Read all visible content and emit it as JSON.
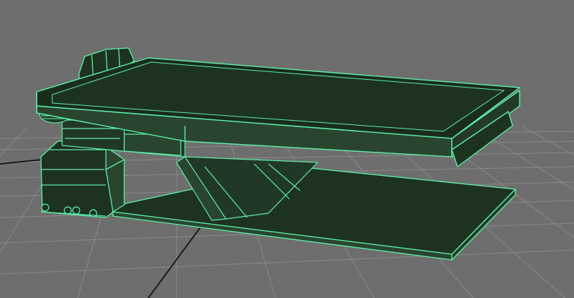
{
  "viewport": {
    "background_color": "#6e6e6e",
    "grid_color": "#8a8a8a",
    "axis_color": "#1a1a1a"
  },
  "model": {
    "fill_dark": "#1e3220",
    "fill_mid": "#243a26",
    "fill_light": "#2a452d",
    "wire_color": "#5cf0a8",
    "wire_highlight": "#8dffc8"
  }
}
